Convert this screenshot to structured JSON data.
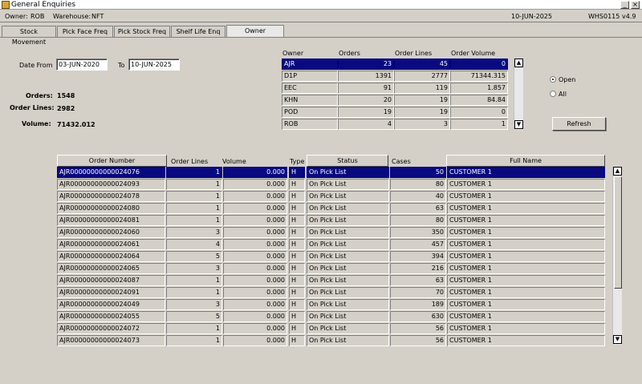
{
  "window": {
    "title": "General Enquiries"
  },
  "info": {
    "owner_label": "Owner:",
    "owner": "ROB",
    "warehouse_label": "Warehouse:",
    "warehouse": "NFT",
    "date": "10-JUN-2025",
    "code": "WHS0115",
    "version": "v4.9"
  },
  "tabs": [
    "Stock Movement",
    "Pick Face Freq",
    "Pick Stock Freq",
    "Shelf Life Enq",
    "Owner"
  ],
  "filters": {
    "date_from_label": "Date From",
    "date_from": "03-JUN-2020",
    "to_label": "To",
    "date_to": "10-JUN-2025"
  },
  "summary": {
    "orders_label": "Orders:",
    "orders": "1548",
    "lines_label": "Order Lines:",
    "lines": "2982",
    "volume_label": "Volume:",
    "volume": "71432.012"
  },
  "owner_table": {
    "headers": [
      "Owner",
      "Orders",
      "Order Lines",
      "Order Volume"
    ],
    "rows": [
      [
        "AJR",
        "23",
        "45",
        "0"
      ],
      [
        "D1P",
        "1391",
        "2777",
        "71344.315"
      ],
      [
        "EEC",
        "91",
        "119",
        "1.857"
      ],
      [
        "KHN",
        "20",
        "19",
        "84.84"
      ],
      [
        "POD",
        "19",
        "19",
        "0"
      ],
      [
        "ROB",
        "4",
        "3",
        "1"
      ]
    ]
  },
  "status_filter": {
    "open": "Open",
    "all": "All",
    "selected": "Open"
  },
  "refresh_label": "Refresh",
  "orders_table": {
    "headers": [
      "Order Number",
      "Order Lines",
      "Volume",
      "Type",
      "Status",
      "Cases",
      "Full Name"
    ],
    "rows": [
      [
        "AJR00000000000024076",
        "1",
        "0.000",
        "H",
        "On Pick List",
        "50",
        "CUSTOMER 1"
      ],
      [
        "AJR00000000000024093",
        "1",
        "0.000",
        "H",
        "On Pick List",
        "80",
        "CUSTOMER 1"
      ],
      [
        "AJR00000000000024078",
        "1",
        "0.000",
        "H",
        "On Pick List",
        "40",
        "CUSTOMER 1"
      ],
      [
        "AJR00000000000024080",
        "1",
        "0.000",
        "H",
        "On Pick List",
        "63",
        "CUSTOMER 1"
      ],
      [
        "AJR00000000000024081",
        "1",
        "0.000",
        "H",
        "On Pick List",
        "80",
        "CUSTOMER 1"
      ],
      [
        "AJR00000000000024060",
        "3",
        "0.000",
        "H",
        "On Pick List",
        "350",
        "CUSTOMER 1"
      ],
      [
        "AJR00000000000024061",
        "4",
        "0.000",
        "H",
        "On Pick List",
        "457",
        "CUSTOMER 1"
      ],
      [
        "AJR00000000000024064",
        "5",
        "0.000",
        "H",
        "On Pick List",
        "394",
        "CUSTOMER 1"
      ],
      [
        "AJR00000000000024065",
        "3",
        "0.000",
        "H",
        "On Pick List",
        "216",
        "CUSTOMER 1"
      ],
      [
        "AJR00000000000024087",
        "1",
        "0.000",
        "H",
        "On Pick List",
        "63",
        "CUSTOMER 1"
      ],
      [
        "AJR00000000000024091",
        "1",
        "0.000",
        "H",
        "On Pick List",
        "70",
        "CUSTOMER 1"
      ],
      [
        "AJR00000000000024049",
        "3",
        "0.000",
        "H",
        "On Pick List",
        "189",
        "CUSTOMER 1"
      ],
      [
        "AJR00000000000024055",
        "5",
        "0.000",
        "H",
        "On Pick List",
        "630",
        "CUSTOMER 1"
      ],
      [
        "AJR00000000000024072",
        "1",
        "0.000",
        "H",
        "On Pick List",
        "56",
        "CUSTOMER 1"
      ],
      [
        "AJR00000000000024073",
        "1",
        "0.000",
        "H",
        "On Pick List",
        "56",
        "CUSTOMER 1"
      ]
    ]
  },
  "icons": {
    "window": "app-icon",
    "minimize": "minimize-icon",
    "close": "close-icon",
    "scroll_up": "arrow-up-icon",
    "scroll_down": "arrow-down-icon"
  }
}
